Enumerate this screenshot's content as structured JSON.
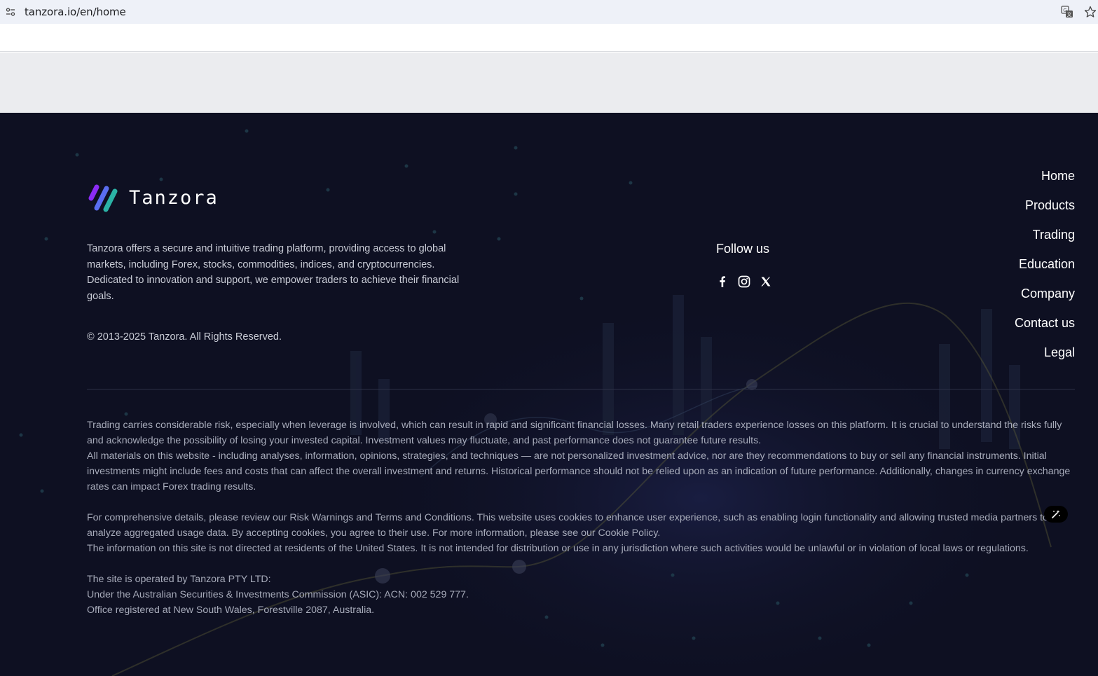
{
  "browser": {
    "url": "tanzora.io/en/home"
  },
  "brand": {
    "name": "Tanzora",
    "logo_colors": [
      "#8b2cf5",
      "#2bb3a6"
    ]
  },
  "footer": {
    "about": "Tanzora offers a secure and intuitive trading platform, providing access to global markets, including Forex, stocks, commodities, indices, and cryptocurrencies. Dedicated to innovation and support, we empower traders to achieve their financial goals.",
    "copyright": "© 2013-2025 Tanzora. All Rights Reserved.",
    "follow_label": "Follow us",
    "socials": [
      "facebook-icon",
      "instagram-icon",
      "x-icon"
    ],
    "nav": [
      "Home",
      "Products",
      "Trading",
      "Education",
      "Company",
      "Contact us",
      "Legal"
    ],
    "disclaimer": [
      "Trading carries considerable risk, especially when leverage is involved, which can result in rapid and significant financial losses. Many retail traders experience losses on this platform. It is crucial to understand the risks fully and acknowledge the possibility of losing your invested capital. Investment values may fluctuate, and past performance does not guarantee future results.",
      "All materials on this website - including analyses, information, opinions, strategies, and techniques — are not personalized investment advice, nor are they recommendations to buy or sell any financial instruments. Initial investments might include fees and costs that can affect the overall investment and returns. Historical performance should not be relied upon as an indication of future performance. Additionally, changes in currency exchange rates can impact Forex trading results.",
      "For comprehensive details, please review our Risk Warnings and Terms and Conditions. This website uses cookies to enhance user experience, such as enabling login functionality and allowing trusted media partners to analyze aggregated usage data. By accepting cookies, you agree to their use. For more information, please see our Cookie Policy.",
      "The information on this site is not directed at residents of the United States. It is not intended for distribution or use in any jurisdiction where such activities would be unlawful or in violation of local laws or regulations.",
      "The site is operated by Tanzora PTY LTD:",
      "Under the Australian Securities & Investments Commission (ASIC): ACN: 002 529 777.",
      "Office registered at New South Wales, Forestville 2087, Australia."
    ]
  },
  "colors": {
    "footer_bg": "#0e1022",
    "text_muted": "#a7abba",
    "browser_bar": "#eef1f8"
  }
}
